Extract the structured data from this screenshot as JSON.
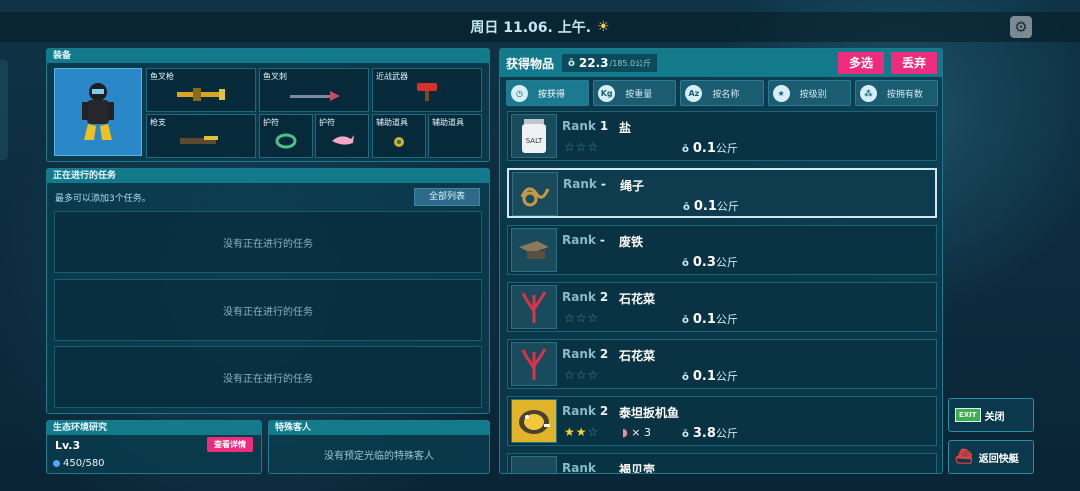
{
  "topbar": {
    "date": "周日 11.06. 上午.",
    "weather_icon": "sun-icon"
  },
  "equipment": {
    "title": "装备",
    "slots": [
      {
        "label": "鱼叉枪",
        "icon": "harpoon-gun-icon"
      },
      {
        "label": "鱼叉刺",
        "icon": "harpoon-spear-icon"
      },
      {
        "label": "近战武器",
        "icon": "melee-weapon-icon"
      },
      {
        "label": "枪支",
        "icon": "gun-icon"
      },
      {
        "label": "护符",
        "icon": "amulet-icon"
      },
      {
        "label": "护符",
        "icon": "dolphin-charm-icon"
      },
      {
        "label": "辅助道具",
        "icon": "aux-item-icon"
      },
      {
        "label": "辅助道具",
        "icon": ""
      }
    ]
  },
  "quests": {
    "title": "正在进行的任务",
    "hint": "最多可以添加3个任务。",
    "all_list_label": "全部列表",
    "empty_slots": [
      "没有正在进行的任务",
      "没有正在进行的任务",
      "没有正在进行的任务"
    ]
  },
  "eco": {
    "title": "生态环境研究",
    "level": "Lv.3",
    "detail_label": "查看详情",
    "xp": "450/580"
  },
  "guest": {
    "title": "特殊客人",
    "empty": "没有预定光临的特殊客人"
  },
  "items": {
    "title": "获得物品",
    "weight": "22.3",
    "max_weight": "/185.0公斤",
    "multi_select": "多选",
    "discard": "丢弃",
    "tabs": [
      {
        "label": "按获得",
        "icon": "clock-icon"
      },
      {
        "label": "按重量",
        "icon": "kg-icon"
      },
      {
        "label": "按名称",
        "icon": "az-icon"
      },
      {
        "label": "按级别",
        "icon": "star-icon"
      },
      {
        "label": "按拥有数",
        "icon": "group-icon"
      }
    ],
    "list": [
      {
        "rank_label": "Rank",
        "rank": "1",
        "name": "盐",
        "stars": 0,
        "weight": "0.1",
        "unit": "公斤",
        "bait": ""
      },
      {
        "rank_label": "Rank",
        "rank": "-",
        "name": "绳子",
        "stars": -1,
        "weight": "0.1",
        "unit": "公斤",
        "bait": ""
      },
      {
        "rank_label": "Rank",
        "rank": "-",
        "name": "废铁",
        "stars": -1,
        "weight": "0.3",
        "unit": "公斤",
        "bait": ""
      },
      {
        "rank_label": "Rank",
        "rank": "2",
        "name": "石花菜",
        "stars": 0,
        "weight": "0.1",
        "unit": "公斤",
        "bait": ""
      },
      {
        "rank_label": "Rank",
        "rank": "2",
        "name": "石花菜",
        "stars": 0,
        "weight": "0.1",
        "unit": "公斤",
        "bait": ""
      },
      {
        "rank_label": "Rank",
        "rank": "2",
        "name": "泰坦扳机鱼",
        "stars": 2,
        "weight": "3.8",
        "unit": "公斤",
        "bait": "× 3"
      },
      {
        "rank_label": "Rank",
        "rank": "",
        "name": "褐贝壳",
        "stars": 0,
        "weight": "",
        "unit": "",
        "bait": ""
      }
    ]
  },
  "side": {
    "close_label": "关闭",
    "exit_badge": "EXIT",
    "return_label": "返回快艇"
  }
}
